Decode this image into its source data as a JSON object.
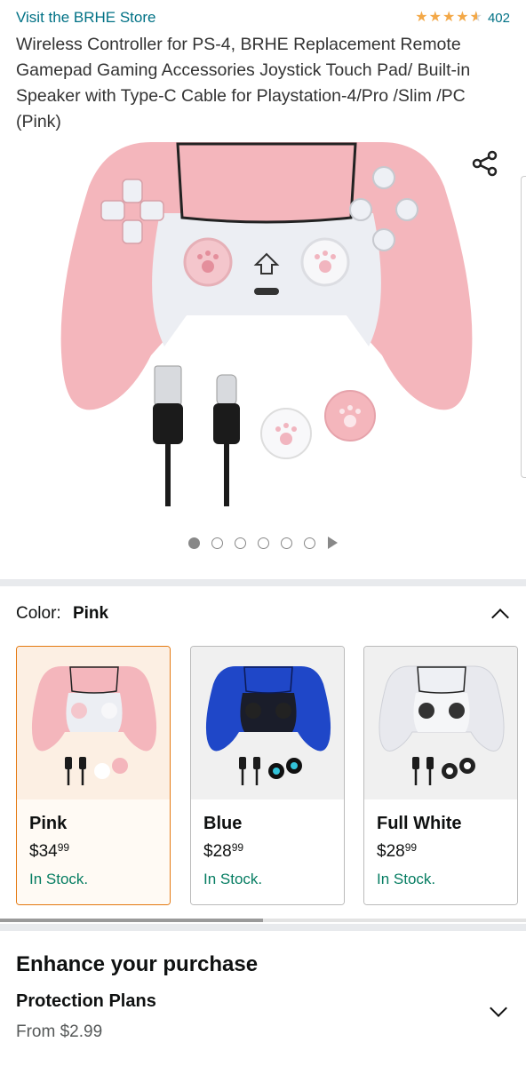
{
  "header": {
    "store_link": "Visit the BRHE Store",
    "rating_stars": 4.5,
    "rating_count": "402"
  },
  "product": {
    "title": "Wireless Controller for PS-4, BRHE Replacement Remote Gamepad Gaming Accessories Joystick Touch Pad/ Built-in Speaker with Type-C Cable for Playstation-4/Pro /Slim /PC (Pink)"
  },
  "gallery": {
    "image_count": 6,
    "active_index": 0,
    "has_video": true,
    "share_icon": "share-icon"
  },
  "color_selector": {
    "label": "Color:",
    "selected": "Pink",
    "variants": [
      {
        "name": "Pink",
        "price_whole": "$34",
        "price_fraction": "99",
        "stock": "In Stock.",
        "color": "#f4b8bd",
        "selected": true
      },
      {
        "name": "Blue",
        "price_whole": "$28",
        "price_fraction": "99",
        "stock": "In Stock.",
        "color": "#1f47c8",
        "selected": false
      },
      {
        "name": "Full White",
        "price_whole": "$28",
        "price_fraction": "99",
        "stock": "In Stock.",
        "color": "#e8e9ee",
        "selected": false
      }
    ]
  },
  "enhance": {
    "title": "Enhance your purchase",
    "protection_title": "Protection Plans",
    "protection_price": "From $2.99"
  },
  "colors": {
    "link": "#007185",
    "star": "#f3a847",
    "in_stock": "#067d62",
    "selected_border": "#e47911"
  }
}
